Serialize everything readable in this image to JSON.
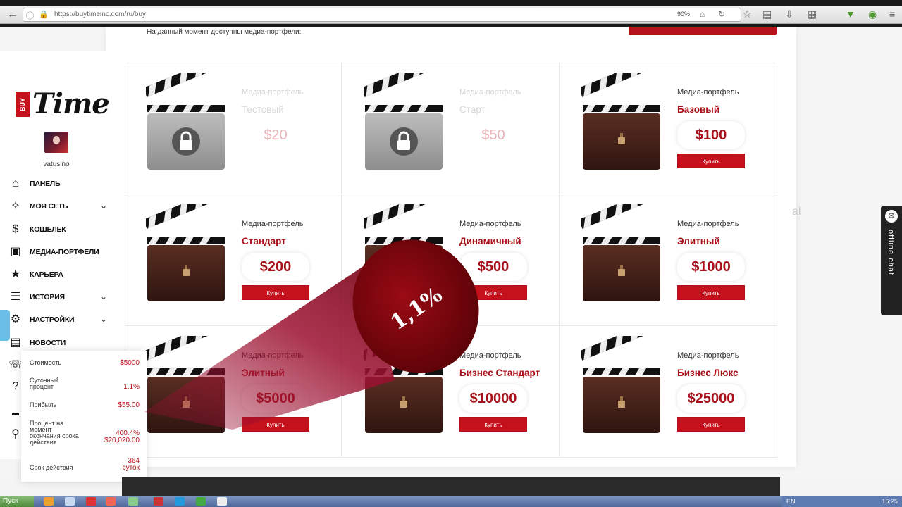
{
  "browser": {
    "url": "https://buytimeinc.com/ru/buy",
    "zoom": "90%"
  },
  "page": {
    "note": "На данный момент доступны медиа-портфели:"
  },
  "sidebar": {
    "logo_badge": "BUY",
    "logo_text": "Time",
    "username": "vatusino",
    "items": [
      {
        "label": "Панель",
        "icon": "home-icon"
      },
      {
        "label": "Моя сеть",
        "icon": "network-icon",
        "expandable": true
      },
      {
        "label": "Кошелек",
        "icon": "dollar-icon"
      },
      {
        "label": "Медиа-портфели",
        "icon": "briefcase-icon"
      },
      {
        "label": "Карьера",
        "icon": "star-icon"
      },
      {
        "label": "История",
        "icon": "list-icon",
        "expandable": true
      },
      {
        "label": "Настройки",
        "icon": "gears-icon",
        "expandable": true
      },
      {
        "label": "Новости",
        "icon": "newspaper-icon"
      }
    ]
  },
  "popup": {
    "rows": [
      {
        "label": "Стоимость",
        "value": "$5000"
      },
      {
        "label": "Суточный процент",
        "value": "1.1%"
      },
      {
        "label": "Прибыль",
        "value": "$55.00"
      },
      {
        "label": "Процент на момент окончания срока действия",
        "value": "400.4% $20,020.00"
      },
      {
        "label": "Срок действия",
        "value": "364 суток"
      }
    ]
  },
  "portfolios": [
    {
      "kicker": "Медиа-портфель",
      "name": "Тестовый",
      "price": "$20",
      "locked": true
    },
    {
      "kicker": "Медиа-портфель",
      "name": "Старт",
      "price": "$50",
      "locked": true
    },
    {
      "kicker": "Медиа-портфель",
      "name": "Базовый",
      "price": "$100",
      "buy": "Купить"
    },
    {
      "kicker": "Медиа-портфель",
      "name": "Стандарт",
      "price": "$200",
      "buy": "Купить"
    },
    {
      "kicker": "Медиа-портфель",
      "name": "Динамичный",
      "price": "$500",
      "buy": "Купить"
    },
    {
      "kicker": "Медиа-портфель",
      "name": "Элитный",
      "price": "$1000",
      "buy": "Купить"
    },
    {
      "kicker": "Медиа-портфель",
      "name": "Элитный",
      "price": "$5000",
      "buy": "Купить"
    },
    {
      "kicker": "Медиа-портфель",
      "name": "Бизнес Стандарт",
      "price": "$10000",
      "buy": "Купить"
    },
    {
      "kicker": "Медиа-портфель",
      "name": "Бизнес Люкс",
      "price": "$25000",
      "buy": "Купить"
    }
  ],
  "overlay": {
    "percent": "1,1%"
  },
  "chat": {
    "label": "offline chat"
  },
  "taskbar": {
    "start": "Пуск",
    "lang": "EN",
    "clock": "16:25"
  },
  "colors": {
    "accent": "#c4111c",
    "accent_dark": "#a8101a"
  }
}
